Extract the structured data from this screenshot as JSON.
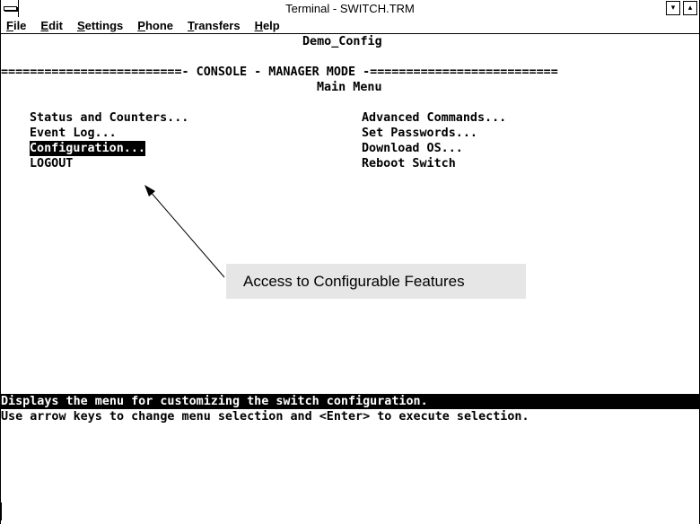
{
  "window": {
    "title": "Terminal - SWITCH.TRM",
    "system_menu_icon": "system-menu-icon",
    "minimize_icon": "▾",
    "maximize_icon": "▴"
  },
  "menubar": {
    "items": [
      {
        "hotkey": "F",
        "rest": "ile"
      },
      {
        "hotkey": "E",
        "rest": "dit"
      },
      {
        "hotkey": "S",
        "rest": "ettings"
      },
      {
        "hotkey": "P",
        "rest": "hone"
      },
      {
        "hotkey": "T",
        "rest": "ransfers"
      },
      {
        "hotkey": "H",
        "rest": "elp"
      }
    ]
  },
  "terminal": {
    "header": "Demo_Config",
    "mode_line": "=========================- CONSOLE - MANAGER MODE -==========================",
    "menu_title": "Main Menu",
    "left_items": [
      "Status and Counters...",
      "Event Log...",
      "Configuration...",
      "LOGOUT"
    ],
    "right_items": [
      "Advanced Commands...",
      "Set Passwords...",
      "Download OS...",
      "Reboot Switch"
    ],
    "selected_item": "Configuration...",
    "status_line": "Displays the menu for customizing the switch configuration.",
    "help_line": "Use arrow keys to change menu selection and <Enter> to execute selection."
  },
  "callout": {
    "text": "Access to Configurable Features"
  }
}
